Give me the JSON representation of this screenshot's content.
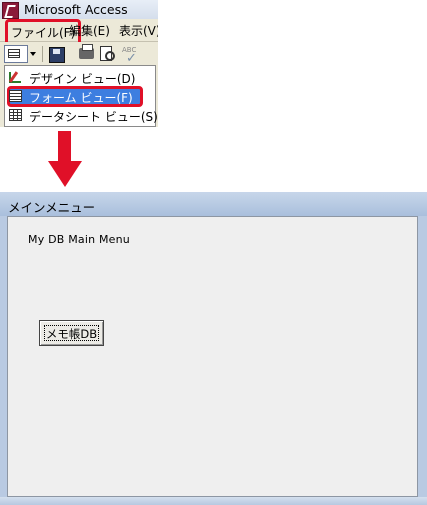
{
  "access": {
    "title": "Microsoft Access",
    "menu": {
      "file": "ファイル(F)",
      "edit": "編集(E)",
      "view": "表示(V)"
    },
    "toolbar": {
      "spell_label": "ABC"
    },
    "view_menu": {
      "items": [
        {
          "label": "デザイン ビュー(D)",
          "icon": "design-view-icon"
        },
        {
          "label": "フォーム ビュー(F)",
          "icon": "form-view-icon",
          "selected": true
        },
        {
          "label": "データシート ビュー(S)",
          "icon": "datasheet-view-icon"
        }
      ]
    },
    "highlight_color": "#e01028"
  },
  "form": {
    "window_title": "メインメニュー",
    "heading": "My DB Main Menu",
    "memo_button": "メモ帳DB"
  },
  "colors": {
    "accent_red": "#e01028",
    "selection_blue": "#3d7ee0",
    "frame_blue": "#b9cae2"
  }
}
